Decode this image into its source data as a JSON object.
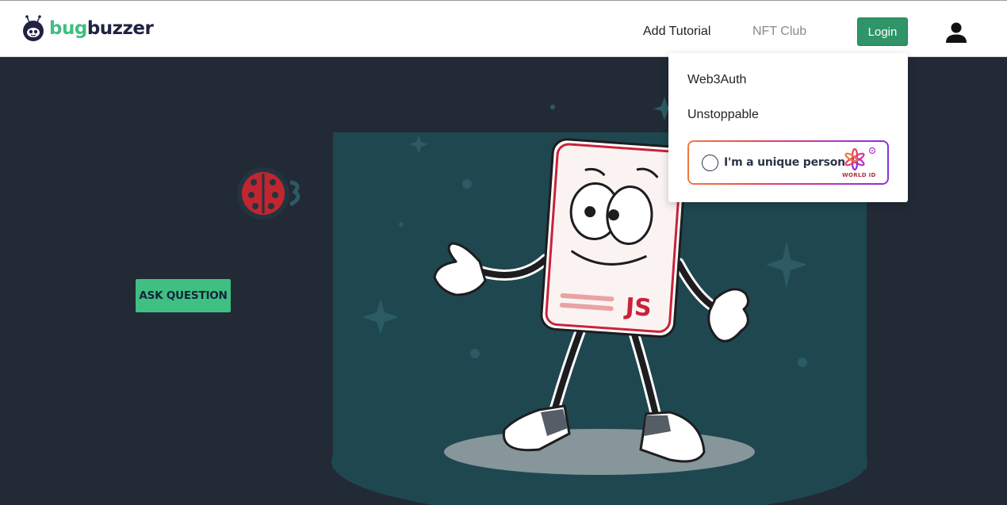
{
  "app": {
    "brand": {
      "part1": "bug",
      "part2": "buzzer"
    }
  },
  "nav": {
    "add_tutorial": "Add Tutorial",
    "nft_club": "NFT Club",
    "login": "Login",
    "user_icon": "user-icon"
  },
  "hero": {
    "ask_button": "ASK QUESTION",
    "illustration_badge": "JS"
  },
  "login_menu": {
    "items": [
      "Web3Auth",
      "Unstoppable"
    ],
    "worldid": {
      "label": "I'm a unique person",
      "logo_text": "WORLD ID"
    }
  },
  "colors": {
    "brand_green": "#3fbf82",
    "brand_navy": "#1f2243",
    "login_green": "#2f9468",
    "hero_bg": "#222a36",
    "spotlight": "#1f4750"
  }
}
